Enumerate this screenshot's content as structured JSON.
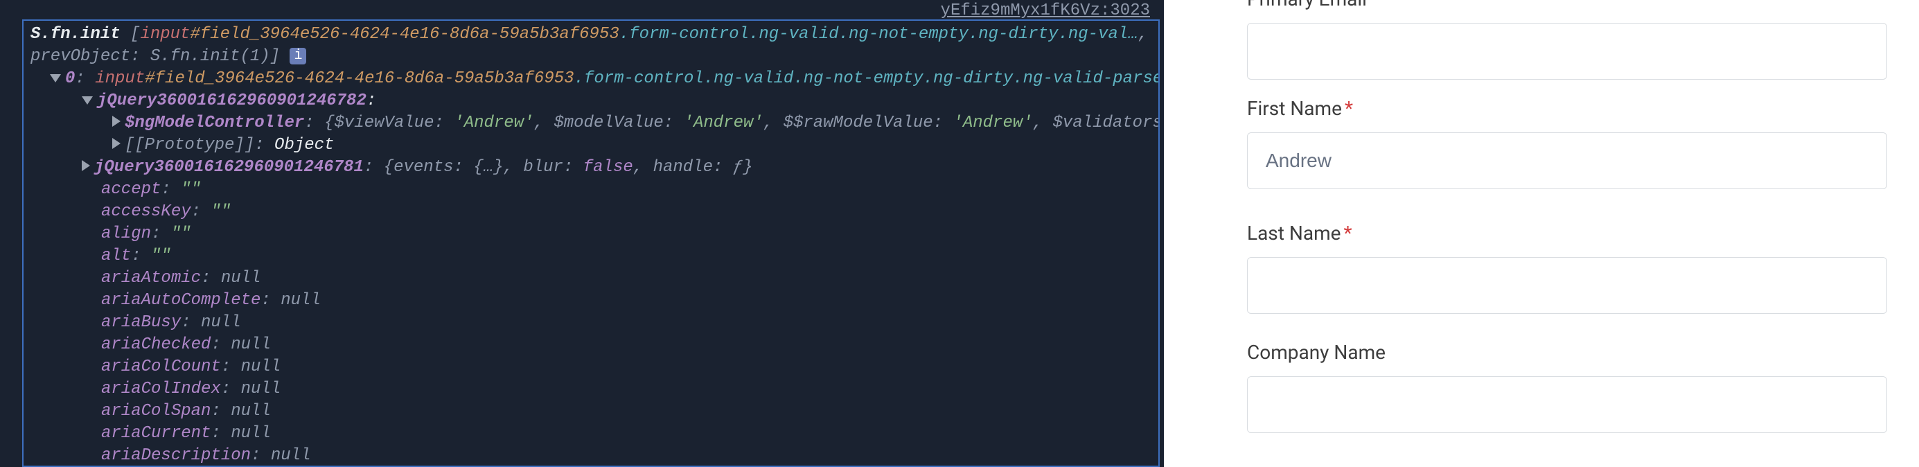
{
  "devtools": {
    "source_label": "yEfiz9mMyx1fK6Vz:3023",
    "line1_a": "S.fn.init ",
    "line1_b": "[",
    "line1_c": "input",
    "line1_d": "#field_3964e526-4624-4e16-8d6a-59a5b3af6953",
    "line1_e": ".form-control.ng-valid.ng-not-empty.ng-dirty.ng-val…",
    "line1_f": ",",
    "line2_a": "prevObject: S.fn.init(1)]",
    "badge": "i",
    "line3_a": "0",
    "line3_b": ": ",
    "line3_c": "input",
    "line3_d": "#field_3964e526-4624-4e16-8d6a-59a5b3af6953",
    "line3_e": ".form-control.ng-valid.ng-not-empty.ng-dirty.ng-valid-parse.",
    "line4_a": "jQuery360016162960901246782",
    "line4_b": ":",
    "line5_a": "$ngModelController",
    "line5_b": ": ",
    "line5_c": "{$viewValue: ",
    "line5_d": "'Andrew'",
    "line5_e": ", $modelValue: ",
    "line5_f": "'Andrew'",
    "line5_g": ", $$rawModelValue: ",
    "line5_h": "'Andrew'",
    "line5_i": ", $validators: {.",
    "line6_a": "[[Prototype]]:",
    "line6_b": " Object",
    "line7_a": "jQuery360016162960901246781",
    "line7_b": ": ",
    "line7_c": "{events: ",
    "line7_d": "{…}",
    "line7_e": ", blur: ",
    "line7_f": "false",
    "line7_g": ", handle: ",
    "line7_h": "ƒ",
    "line7_i": "}",
    "prop_accept": "accept",
    "prop_accessKey": "accessKey",
    "prop_align": "align",
    "prop_alt": "alt",
    "prop_ariaAtomic": "ariaAtomic",
    "prop_ariaAutoComplete": "ariaAutoComplete",
    "prop_ariaBusy": "ariaBusy",
    "prop_ariaChecked": "ariaChecked",
    "prop_ariaColCount": "ariaColCount",
    "prop_ariaColIndex": "ariaColIndex",
    "prop_ariaColSpan": "ariaColSpan",
    "prop_ariaCurrent": "ariaCurrent",
    "prop_ariaDescription": "ariaDescription",
    "colon": ": ",
    "val_empty": "\"\"",
    "val_null": "null"
  },
  "form": {
    "primary_label": "Primary Email",
    "first_label": "First Name",
    "last_label": "Last Name",
    "company_label": "Company Name",
    "required_marker": "*",
    "first_value": "Andrew"
  }
}
